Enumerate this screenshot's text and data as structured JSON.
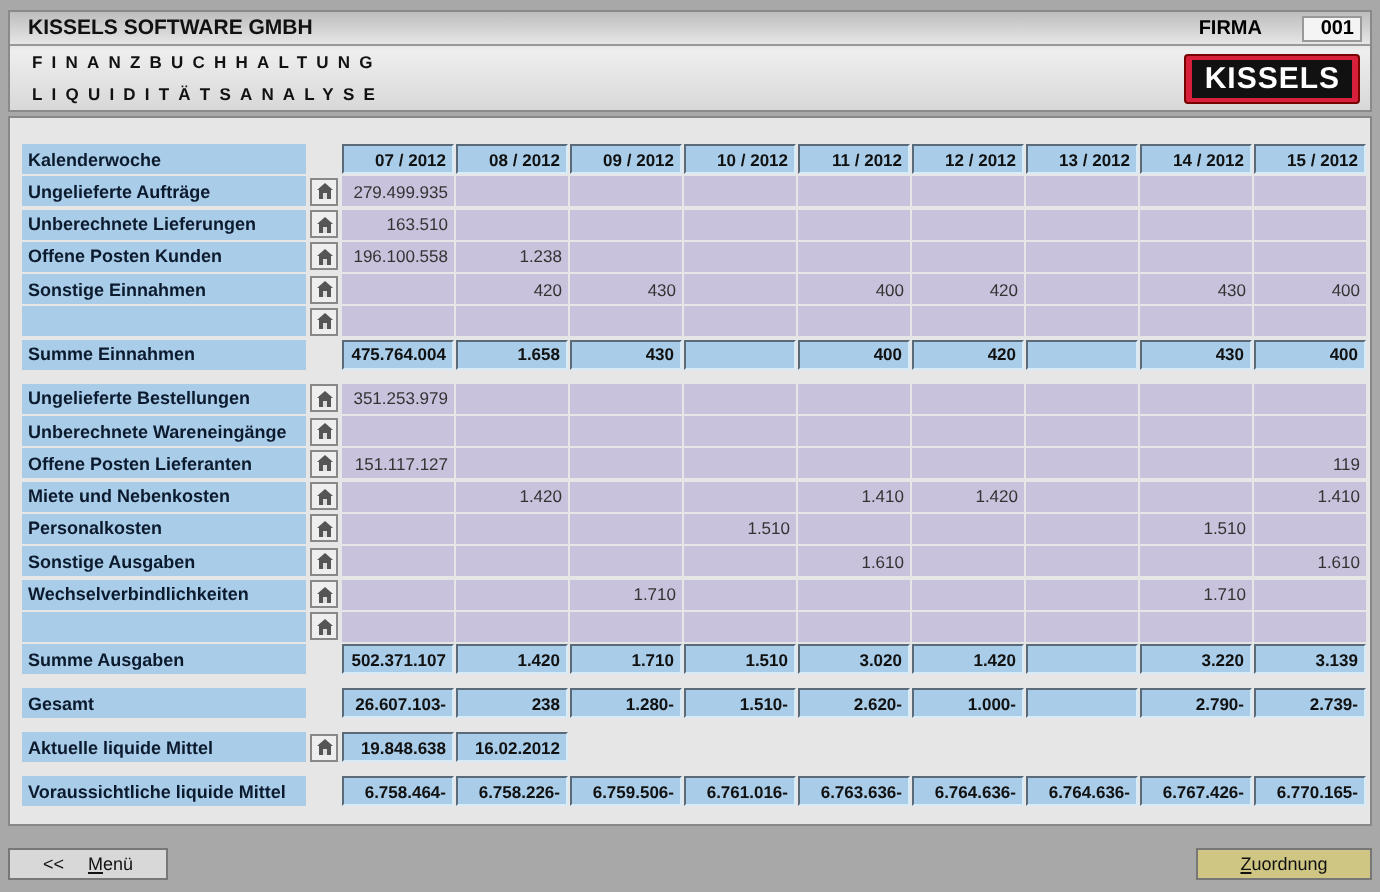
{
  "header": {
    "company": "KISSELS SOFTWARE GMBH",
    "firma_label": "FIRMA",
    "firma_value": "001",
    "module": "FINANZBUCHHALTUNG",
    "screen": "LIQUIDITÄTSANALYSE",
    "logo": "KISSELS"
  },
  "sections": [
    {
      "rows": [
        {
          "kind": "header",
          "label": "Kalenderwoche",
          "button": false,
          "cells": [
            "07 / 2012",
            "08 / 2012",
            "09 / 2012",
            "10 / 2012",
            "11 / 2012",
            "12 / 2012",
            "13 / 2012",
            "14 / 2012",
            "15 / 2012"
          ]
        },
        {
          "kind": "data",
          "label": "Ungelieferte Aufträge",
          "button": true,
          "cells": [
            "279.499.935",
            null,
            null,
            null,
            null,
            null,
            null,
            null,
            null
          ]
        },
        {
          "kind": "data",
          "label": "Unberechnete Lieferungen",
          "button": true,
          "cells": [
            "163.510",
            null,
            null,
            null,
            null,
            null,
            null,
            null,
            null
          ]
        },
        {
          "kind": "data",
          "label": "Offene Posten Kunden",
          "button": true,
          "cells": [
            "196.100.558",
            "1.238",
            null,
            null,
            null,
            null,
            null,
            null,
            null
          ]
        },
        {
          "kind": "data",
          "label": "Sonstige Einnahmen",
          "button": true,
          "cells": [
            null,
            "420",
            "430",
            null,
            "400",
            "420",
            null,
            "430",
            "400"
          ]
        },
        {
          "kind": "data",
          "label": null,
          "button": true,
          "cells": [
            null,
            null,
            null,
            null,
            null,
            null,
            null,
            null,
            null
          ]
        },
        {
          "kind": "sum",
          "label": "Summe Einnahmen",
          "button": false,
          "cells": [
            "475.764.004",
            "1.658",
            "430",
            null,
            "400",
            "420",
            null,
            "430",
            "400"
          ]
        }
      ]
    },
    {
      "rows": [
        {
          "kind": "data",
          "label": "Ungelieferte Bestellungen",
          "button": true,
          "cells": [
            "351.253.979",
            null,
            null,
            null,
            null,
            null,
            null,
            null,
            null
          ]
        },
        {
          "kind": "data",
          "label": "Unberechnete Wareneingänge",
          "button": true,
          "cells": [
            null,
            null,
            null,
            null,
            null,
            null,
            null,
            null,
            null
          ]
        },
        {
          "kind": "data",
          "label": "Offene Posten Lieferanten",
          "button": true,
          "cells": [
            "151.117.127",
            null,
            null,
            null,
            null,
            null,
            null,
            null,
            "119"
          ]
        },
        {
          "kind": "data",
          "label": "Miete und Nebenkosten",
          "button": true,
          "cells": [
            null,
            "1.420",
            null,
            null,
            "1.410",
            "1.420",
            null,
            null,
            "1.410"
          ]
        },
        {
          "kind": "data",
          "label": "Personalkosten",
          "button": true,
          "cells": [
            null,
            null,
            null,
            "1.510",
            null,
            null,
            null,
            "1.510",
            null
          ]
        },
        {
          "kind": "data",
          "label": "Sonstige Ausgaben",
          "button": true,
          "cells": [
            null,
            null,
            null,
            null,
            "1.610",
            null,
            null,
            null,
            "1.610"
          ]
        },
        {
          "kind": "data",
          "label": "Wechselverbindlichkeiten",
          "button": true,
          "cells": [
            null,
            null,
            "1.710",
            null,
            null,
            null,
            null,
            "1.710",
            null
          ]
        },
        {
          "kind": "data",
          "label": null,
          "button": true,
          "cells": [
            null,
            null,
            null,
            null,
            null,
            null,
            null,
            null,
            null
          ]
        },
        {
          "kind": "sum",
          "label": "Summe Ausgaben",
          "button": false,
          "cells": [
            "502.371.107",
            "1.420",
            "1.710",
            "1.510",
            "3.020",
            "1.420",
            null,
            "3.220",
            "3.139"
          ]
        }
      ]
    },
    {
      "rows": [
        {
          "kind": "sum",
          "label": "Gesamt",
          "button": false,
          "cells": [
            "26.607.103-",
            "238",
            "1.280-",
            "1.510-",
            "2.620-",
            "1.000-",
            null,
            "2.790-",
            "2.739-"
          ]
        }
      ]
    },
    {
      "rows": [
        {
          "kind": "sum",
          "label": "Aktuelle liquide Mittel",
          "button": true,
          "cells": [
            "19.848.638",
            "16.02.2012"
          ]
        }
      ]
    },
    {
      "rows": [
        {
          "kind": "sum",
          "label": "Voraussichtliche liquide Mittel",
          "button": false,
          "cells": [
            "6.758.464-",
            "6.758.226-",
            "6.759.506-",
            "6.761.016-",
            "6.763.636-",
            "6.764.636-",
            "6.764.636-",
            "6.767.426-",
            "6.770.165-"
          ]
        }
      ]
    }
  ],
  "footer": {
    "back_prefix": "<<",
    "back_label": "Menü",
    "action_label": "Zuordnung"
  }
}
